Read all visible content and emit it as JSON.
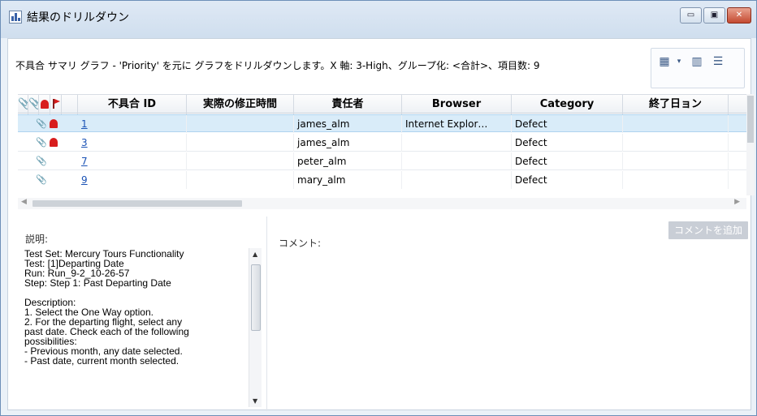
{
  "window": {
    "title": "結果のドリルダウン",
    "buttons": {
      "minimize": "▭",
      "restore": "▣",
      "close": "✕"
    }
  },
  "summary": "不具合 サマリ グラフ - 'Priority' を元に グラフをドリルダウンします。X 軸: 3-High、グループ化: <合計>、項目数: 9",
  "toolbar": {
    "icons": [
      "grid-settings-icon",
      "dropdown-arrow-icon",
      "columns-icon",
      "report-icon"
    ]
  },
  "grid": {
    "columns": [
      "不具合 ID",
      "実際の修正時間",
      "責任者",
      "Browser",
      "Category",
      "終了日ョン"
    ],
    "rows": [
      {
        "id": "1",
        "fix_time": "",
        "owner": "james_alm",
        "browser": "Internet Explor…",
        "category": "Defect",
        "closed": "",
        "attachment": true,
        "alert": true,
        "selected": true
      },
      {
        "id": "3",
        "fix_time": "",
        "owner": "james_alm",
        "browser": "",
        "category": "Defect",
        "closed": "",
        "attachment": true,
        "alert": true,
        "selected": false
      },
      {
        "id": "7",
        "fix_time": "",
        "owner": "peter_alm",
        "browser": "",
        "category": "Defect",
        "closed": "",
        "attachment": true,
        "alert": false,
        "selected": false
      },
      {
        "id": "9",
        "fix_time": "",
        "owner": "mary_alm",
        "browser": "",
        "category": "Defect",
        "closed": "",
        "attachment": true,
        "alert": false,
        "selected": false
      }
    ]
  },
  "details": {
    "description_label": "説明:",
    "comment_label": "コメント:",
    "add_comment_button": "コメントを追加",
    "description_text": "Test Set: Mercury Tours Functionality\nTest: [1]Departing Date\nRun: Run_9-2_10-26-57\nStep: Step 1: Past Departing Date\n\nDescription:\n1. Select the One Way option.\n2. For the departing flight, select any\npast date. Check each of the following\npossibilities:\n- Previous month, any date selected.\n- Past date, current month selected."
  }
}
